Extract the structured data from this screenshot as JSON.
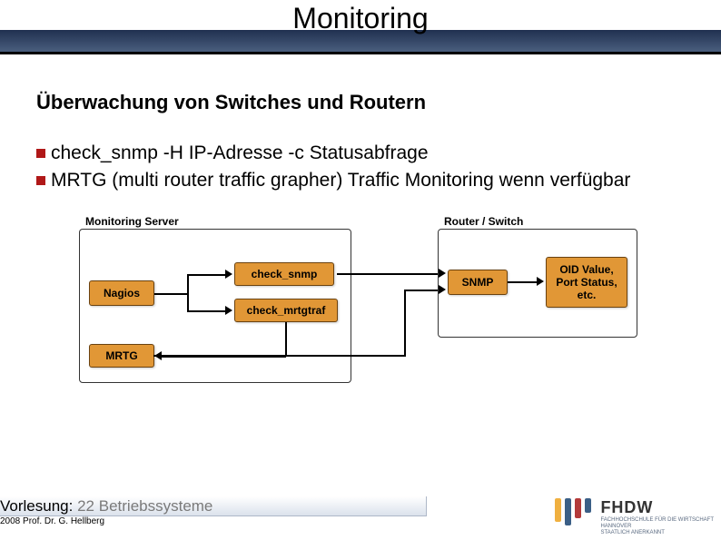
{
  "title": "Monitoring",
  "subtitle": "Überwachung von Switches und Routern",
  "bullets": [
    "check_snmp -H IP-Adresse -c Statusabfrage",
    "MRTG (multi router traffic grapher) Traffic Monitoring wenn verfügbar"
  ],
  "diagram": {
    "groups": {
      "monitoring_server": "Monitoring Server",
      "router_switch": "Router / Switch"
    },
    "boxes": {
      "nagios": "Nagios",
      "mrtg": "MRTG",
      "check_snmp": "check_snmp",
      "check_mrtgtraf": "check_mrtgtraf",
      "snmp": "SNMP",
      "oid": "OID Value,\nPort Status,\netc."
    }
  },
  "footer": {
    "lecture_label": "Vorlesung:",
    "lecture_num": "22",
    "lecture_name": "Betriebssysteme",
    "copyright": "2008 Prof. Dr. G. Hellberg",
    "logo_name": "FHDW",
    "logo_sub1": "FACHHOCHSCHULE FÜR DIE WIRTSCHAFT",
    "logo_sub2": "HANNOVER",
    "logo_sub3": "STAATLICH ANERKANNT"
  }
}
